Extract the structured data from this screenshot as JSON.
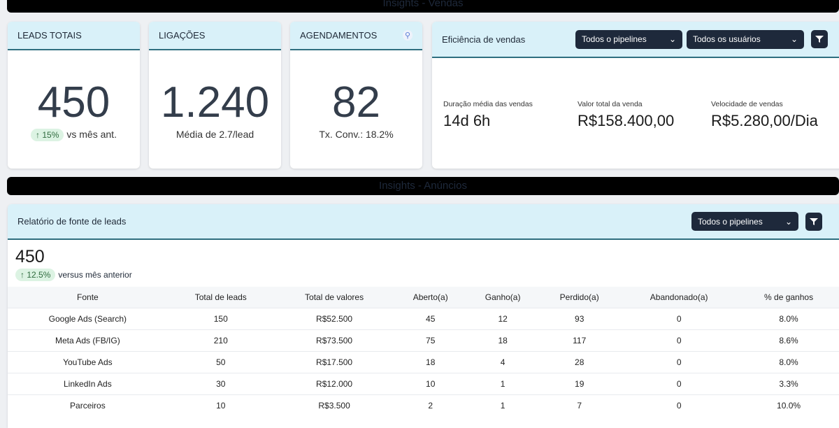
{
  "banners": {
    "sales": "Insights - Vendas",
    "ads": "Insights - Anúncios"
  },
  "kpis": [
    {
      "title": "LEADS TOTAIS",
      "value": "450",
      "badge": "↑ 15%",
      "sub": "vs mês ant."
    },
    {
      "title": "LIGAÇÕES",
      "value": "1.240",
      "sub": "Média de 2.7/lead"
    },
    {
      "title": "AGENDAMENTOS",
      "value": "82",
      "sub": "Tx. Conv.: 18.2%",
      "icon": "pin-icon"
    }
  ],
  "efficiency": {
    "title": "Eficiência de vendas",
    "pipeline_select": "Todos o pipelines",
    "user_select": "Todos os usuários",
    "metrics": [
      {
        "label": "Duração média das vendas",
        "value": "14d 6h"
      },
      {
        "label": "Valor total da venda",
        "value": "R$158.400,00"
      },
      {
        "label": "Velocidade de vendas",
        "value": "R$5.280,00/Dia"
      }
    ]
  },
  "lead_source": {
    "title": "Relatório de fonte de leads",
    "pipeline_select": "Todos o pipelines",
    "total": "450",
    "badge": "↑ 12.5%",
    "compare": "versus mês anterior",
    "columns": [
      "Fonte",
      "Total de leads",
      "Total de valores",
      "Aberto(a)",
      "Ganho(a)",
      "Perdido(a)",
      "Abandonado(a)",
      "% de ganhos"
    ],
    "rows": [
      [
        "Google Ads (Search)",
        "150",
        "R$52.500",
        "45",
        "12",
        "93",
        "0",
        "8.0%"
      ],
      [
        "Meta Ads (FB/IG)",
        "210",
        "R$73.500",
        "75",
        "18",
        "117",
        "0",
        "8.6%"
      ],
      [
        "YouTube Ads",
        "50",
        "R$17.500",
        "18",
        "4",
        "28",
        "0",
        "8.0%"
      ],
      [
        "LinkedIn Ads",
        "30",
        "R$12.000",
        "10",
        "1",
        "19",
        "0",
        "3.3%"
      ],
      [
        "Parceiros",
        "10",
        "R$3.500",
        "2",
        "1",
        "7",
        "0",
        "10.0%"
      ]
    ]
  }
}
